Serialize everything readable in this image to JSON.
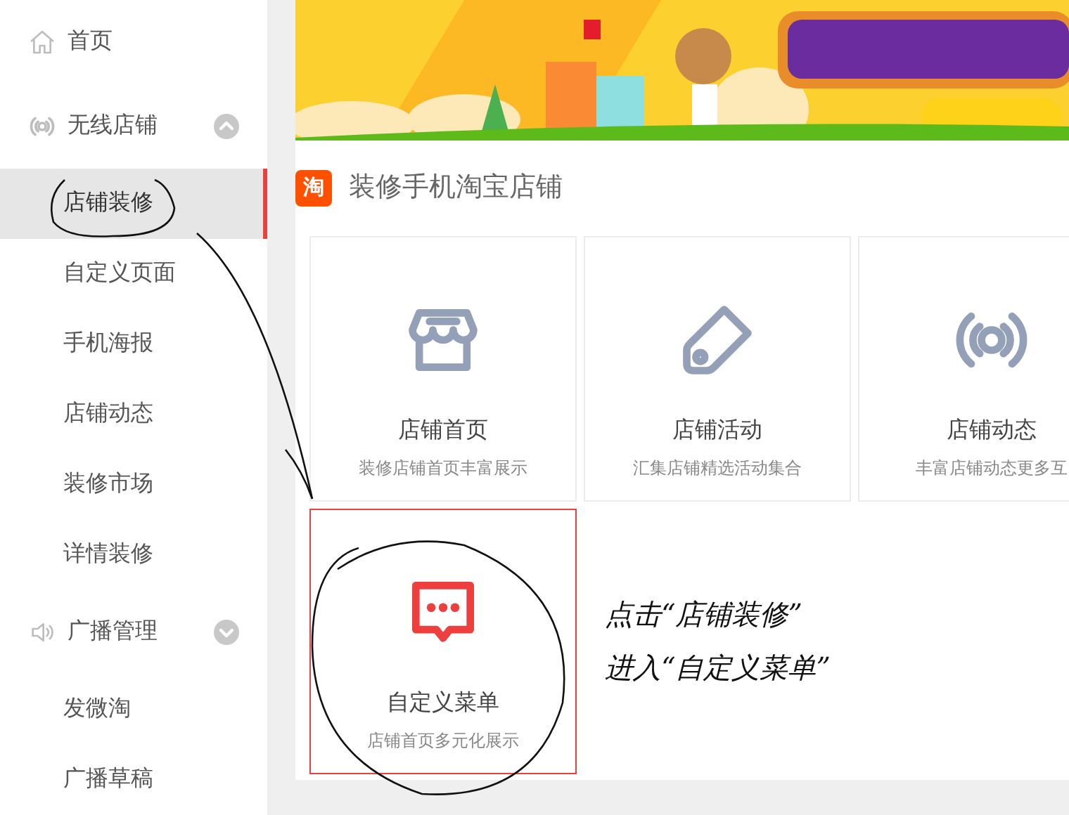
{
  "sidebar": {
    "items": [
      {
        "kind": "link",
        "label": "首页"
      },
      {
        "kind": "group",
        "label": "无线店铺",
        "expanded": true,
        "children": [
          {
            "label": "店铺装修",
            "selected": true
          },
          {
            "label": "自定义页面",
            "selected": false
          },
          {
            "label": "手机海报",
            "selected": false
          },
          {
            "label": "店铺动态",
            "selected": false
          },
          {
            "label": "装修市场",
            "selected": false
          },
          {
            "label": "详情装修",
            "selected": false
          }
        ]
      },
      {
        "kind": "group",
        "label": "广播管理",
        "expanded": false,
        "children": [
          {
            "label": "发微淘",
            "selected": false
          },
          {
            "label": "广播草稿",
            "selected": false
          }
        ]
      }
    ]
  },
  "section": {
    "badge": "淘",
    "title": "装修手机淘宝店铺"
  },
  "cards": [
    {
      "kind": "store",
      "title": "店铺首页",
      "subtitle": "装修店铺首页丰富展示",
      "selected": false
    },
    {
      "kind": "tag",
      "title": "店铺活动",
      "subtitle": "汇集店铺精选活动集合",
      "selected": false
    },
    {
      "kind": "broadcast",
      "title": "店铺动态",
      "subtitle": "丰富店铺动态更多互",
      "selected": false
    },
    {
      "kind": "chat",
      "title": "自定义菜单",
      "subtitle": "店铺首页多元化展示",
      "selected": true
    }
  ],
  "annotation": {
    "lines": [
      "点击“店铺装修”",
      "进入“自定义菜单”"
    ]
  }
}
